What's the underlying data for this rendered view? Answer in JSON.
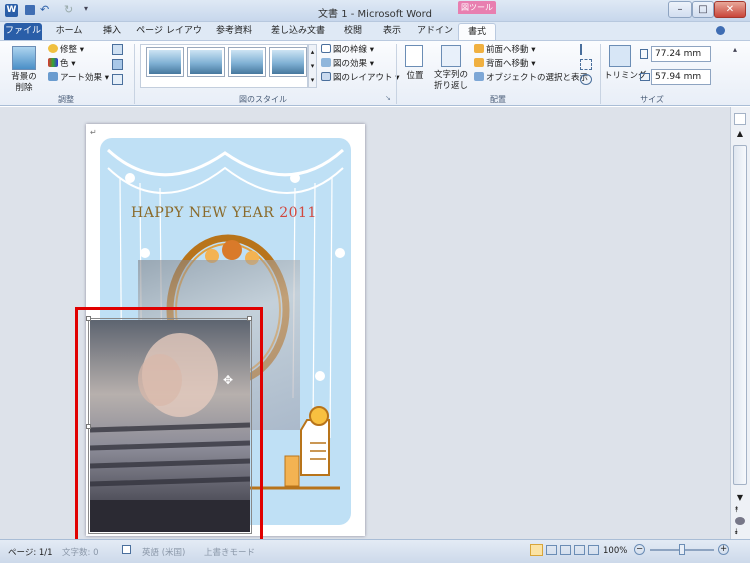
{
  "window": {
    "title": "文書 1 - Microsoft Word",
    "contextual_tab_group": "図ツール",
    "qat": {
      "undo": "↶",
      "redo": "↻"
    }
  },
  "tabs": [
    "ファイル",
    "ホーム",
    "挿入",
    "ページ レイアウト",
    "参考資料",
    "差し込み文書",
    "校閲",
    "表示",
    "アドイン",
    "書式"
  ],
  "ribbon": {
    "adjust": {
      "remove_bg": "背景の",
      "remove_bg2": "削除",
      "corrections": "修整",
      "color": "色",
      "artistic": "アート効果",
      "label": "調整"
    },
    "styles": {
      "border": "図の枠線",
      "effects": "図の効果",
      "layout": "図のレイアウト",
      "label": "図のスタイル"
    },
    "arrange": {
      "position": "位置",
      "wrap1": "文字列の",
      "wrap2": "折り返し",
      "bring_forward": "前面へ移動",
      "send_backward": "背面へ移動",
      "selection_pane": "オブジェクトの選択と表示",
      "label": "配置"
    },
    "size": {
      "crop": "トリミング",
      "height": "77.24 mm",
      "width": "57.94 mm",
      "label": "サイズ"
    }
  },
  "document": {
    "card_greeting": "HAPPY NEW YEAR",
    "card_year": "2011"
  },
  "status": {
    "page": "ページ: 1/1",
    "words": "文字数: 0",
    "language": "英語 (米国)",
    "mode": "上書きモード",
    "zoom": "100%"
  },
  "colors": {
    "accent": "#2a5ea8",
    "card_bg": "#bfe0f5",
    "highlight": "#e00000",
    "tools": "#e87fb0"
  }
}
